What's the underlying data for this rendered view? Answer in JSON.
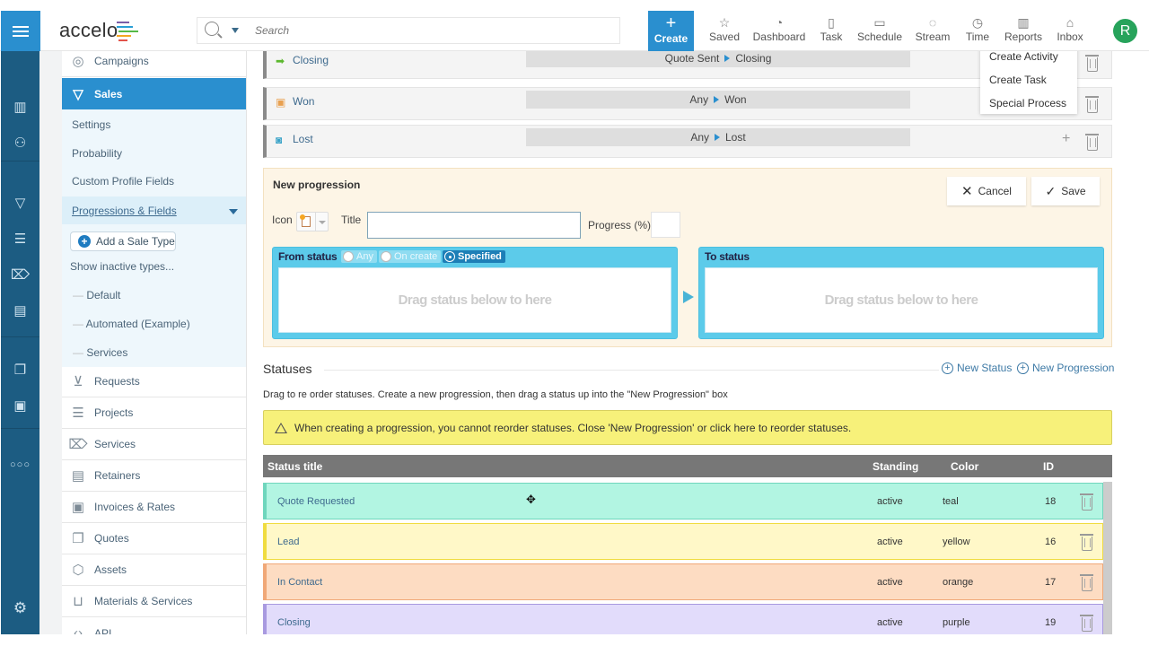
{
  "header": {
    "logo": "accelo",
    "search_placeholder": "Search",
    "create_label": "Create",
    "nav": [
      {
        "label": "Saved",
        "icon": "star-icon"
      },
      {
        "label": "Dashboard",
        "icon": "gauge-icon"
      },
      {
        "label": "Task",
        "icon": "clipboard-icon"
      },
      {
        "label": "Schedule",
        "icon": "calendar-icon"
      },
      {
        "label": "Stream",
        "icon": "chat-icon"
      },
      {
        "label": "Time",
        "icon": "clock-icon"
      },
      {
        "label": "Reports",
        "icon": "bar-chart-icon"
      },
      {
        "label": "Inbox",
        "icon": "inbox-icon"
      }
    ],
    "avatar_initial": "R"
  },
  "subnav": {
    "campaigns": "Campaigns",
    "sales": "Sales",
    "sales_sub": [
      "Settings",
      "Probability",
      "Custom Profile Fields",
      "Progressions & Fields"
    ],
    "add_sale_type": "Add a Sale Type",
    "show_inactive": "Show inactive types...",
    "sale_types": [
      "Default",
      "Automated (Example)",
      "Services"
    ],
    "modules": [
      "Requests",
      "Projects",
      "Services",
      "Retainers",
      "Invoices & Rates",
      "Quotes",
      "Assets",
      "Materials & Services",
      "API"
    ]
  },
  "progressions": [
    {
      "title": "Closing",
      "from": "Quote Sent",
      "to": "Closing"
    },
    {
      "title": "Won",
      "from": "Any",
      "to": "Won"
    },
    {
      "title": "Lost",
      "from": "Any",
      "to": "Lost"
    }
  ],
  "dropdown_menu": [
    "Create Activity",
    "Create Task",
    "Special Process"
  ],
  "new_progression": {
    "title": "New progression",
    "cancel": "Cancel",
    "save": "Save",
    "icon_label": "Icon",
    "title_label": "Title",
    "title_value": "",
    "progress_label": "Progress (%)",
    "progress_value": "",
    "from_status": "From status",
    "from_options": [
      "Any",
      "On create",
      "Specified"
    ],
    "from_selected": "Specified",
    "to_status": "To status",
    "drop_hint": "Drag status below to here"
  },
  "statuses": {
    "heading": "Statuses",
    "new_status": "New Status",
    "new_progression": "New Progression",
    "help": "Drag to re order statuses. Create a new progression, then drag a status up into the \"New Progression\" box",
    "warning": "When creating a progression, you cannot reorder statuses. Close 'New Progression' or click here to reorder statuses.",
    "columns": [
      "Status title",
      "Standing",
      "Color",
      "ID"
    ],
    "rows": [
      {
        "title": "Quote Requested",
        "standing": "active",
        "color": "teal",
        "id": "18",
        "bg": "#b2f5e2",
        "border": "#6fd6bd"
      },
      {
        "title": "Lead",
        "standing": "active",
        "color": "yellow",
        "id": "16",
        "bg": "#fff8c8",
        "border": "#f0dc40"
      },
      {
        "title": "In Contact",
        "standing": "active",
        "color": "orange",
        "id": "17",
        "bg": "#fddcc2",
        "border": "#f0a878"
      },
      {
        "title": "Closing",
        "standing": "active",
        "color": "purple",
        "id": "19",
        "bg": "#e2dcfb",
        "border": "#a99ae0"
      }
    ]
  },
  "colors": {
    "brand_blue": "#2a8fcf",
    "rail": "#1c5c82",
    "avatar": "#27a35b"
  }
}
